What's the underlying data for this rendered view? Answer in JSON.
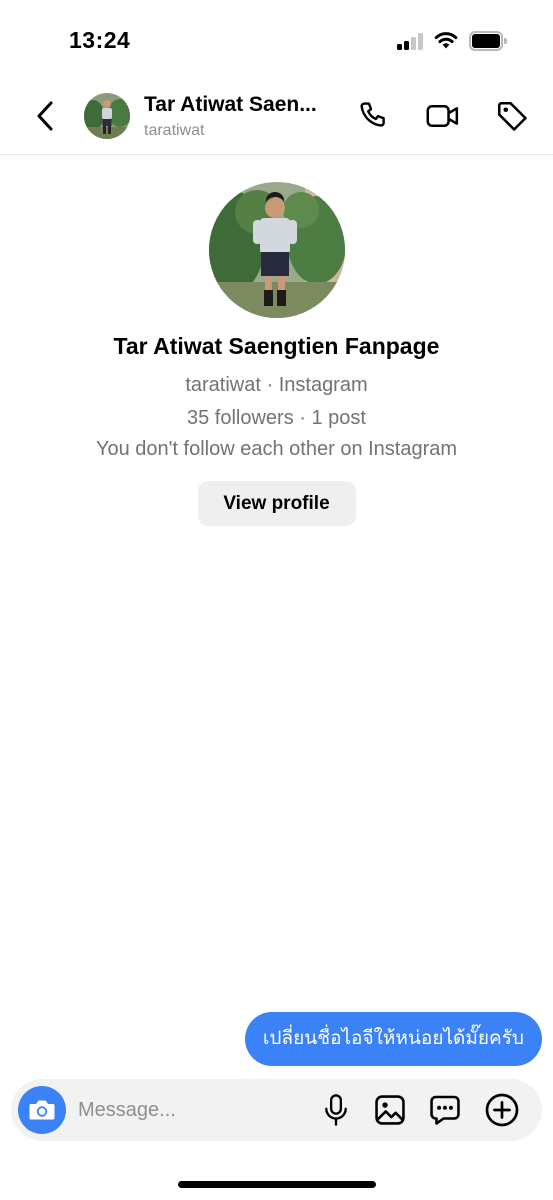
{
  "status_bar": {
    "time": "13:24",
    "signal_bars": 2,
    "signal_bars_total": 4
  },
  "header": {
    "name": "Tar Atiwat Saen...",
    "username": "taratiwat",
    "icons": [
      "back-icon",
      "phone-icon",
      "video-camera-icon",
      "tag-icon"
    ]
  },
  "profile": {
    "name": "Tar Atiwat Saengtien Fanpage",
    "source": "taratiwat · Instagram",
    "stats": "35 followers · 1 post",
    "follow_note": "You don't follow each other on Instagram",
    "view_profile_label": "View profile"
  },
  "messages": [
    {
      "direction": "outgoing",
      "text": "เปลี่ยนชื่อไอจีให้หน่อยได้มั๊ยครับ"
    }
  ],
  "composer": {
    "placeholder": "Message...",
    "icons": [
      "camera-icon",
      "microphone-icon",
      "image-icon",
      "sticker-icon",
      "plus-icon"
    ]
  },
  "colors": {
    "accent": "#3b82f6",
    "secondary_text": "#737373",
    "button_bg": "#efefef"
  }
}
